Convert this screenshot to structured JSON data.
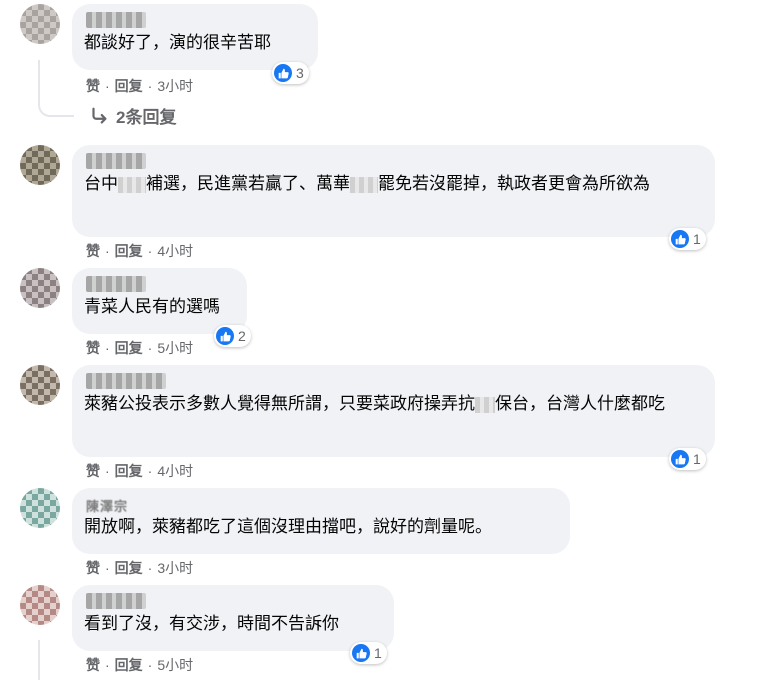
{
  "common": {
    "like_label": "赞",
    "reply_label": "回复",
    "separator": "·"
  },
  "comments": [
    {
      "text": "都談好了，演的很辛苦耶",
      "time": "3小时",
      "reactions": "3"
    },
    {
      "text_parts": [
        "台中",
        "補選，民進黨若贏了、萬華",
        "罷免若沒罷掉，執政者更會為所欲為"
      ],
      "time": "4小时",
      "reactions": "1"
    },
    {
      "text": "青菜人民有的選嗎",
      "time": "5小时",
      "reactions": "2"
    },
    {
      "text_parts": [
        "萊豬公投表示多數人覺得無所謂，只要菜政府操弄抗",
        "保台，台灣人什麼都吃"
      ],
      "time": "4小时",
      "reactions": "1"
    },
    {
      "author": "陳澤宗",
      "text": "開放啊，萊豬都吃了這個沒理由擋吧，說好的劑量呢。",
      "time": "3小时"
    },
    {
      "text": "看到了沒，有交涉，時間不告訴你",
      "time": "5小时",
      "reactions": "1"
    }
  ],
  "replies_link": "2条回复",
  "icons": {
    "like": "thumbs-up-icon",
    "reply_arrow": "reply-arrow-icon"
  },
  "colors": {
    "like_blue": "#1877f2",
    "bubble": "#f0f2f5",
    "meta": "#65676b"
  }
}
